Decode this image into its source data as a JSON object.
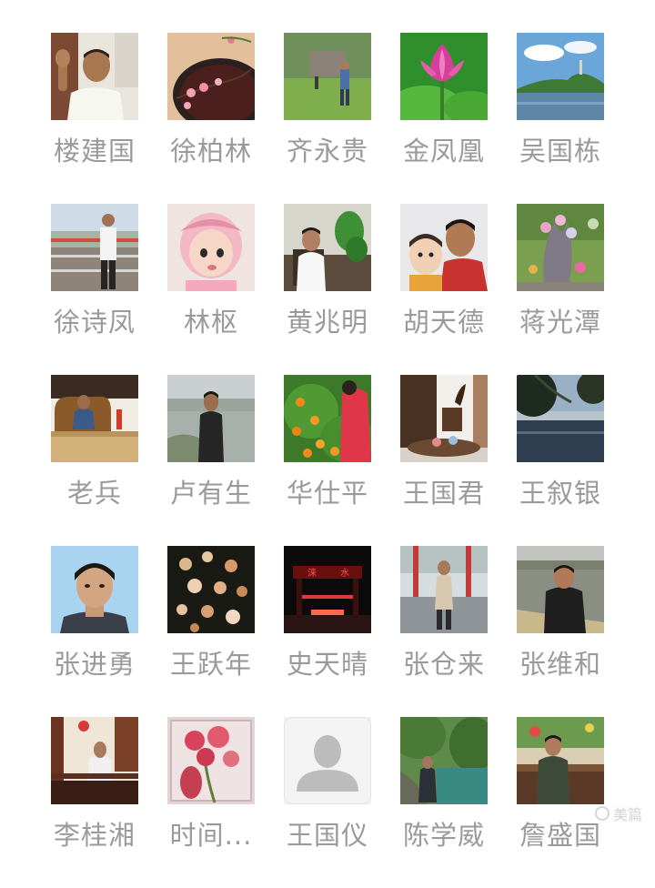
{
  "members": [
    {
      "name": "楼建国",
      "avatar": "photo-man-waving"
    },
    {
      "name": "徐柏林",
      "avatar": "photo-plum-blossom-bowl"
    },
    {
      "name": "齐永贵",
      "avatar": "photo-man-in-field"
    },
    {
      "name": "金凤凰",
      "avatar": "photo-lotus-flower"
    },
    {
      "name": "吴国栋",
      "avatar": "photo-lake-mountain"
    },
    {
      "name": "徐诗凤",
      "avatar": "photo-man-by-railing"
    },
    {
      "name": "林枢",
      "avatar": "photo-baby-pink-hat"
    },
    {
      "name": "黄兆明",
      "avatar": "photo-man-seated-plant"
    },
    {
      "name": "胡天德",
      "avatar": "photo-man-with-child"
    },
    {
      "name": "蒋光潭",
      "avatar": "photo-garden-rockery"
    },
    {
      "name": "老兵",
      "avatar": "photo-man-on-couch"
    },
    {
      "name": "卢有生",
      "avatar": "photo-man-by-lake"
    },
    {
      "name": "华仕平",
      "avatar": "photo-orange-tree"
    },
    {
      "name": "王国君",
      "avatar": "photo-root-carving-room"
    },
    {
      "name": "王叙银",
      "avatar": "photo-lake-trees"
    },
    {
      "name": "张进勇",
      "avatar": "photo-portrait-id"
    },
    {
      "name": "王跃年",
      "avatar": "photo-flowers-dark"
    },
    {
      "name": "史天晴",
      "avatar": "photo-night-gate"
    },
    {
      "name": "张仓来",
      "avatar": "photo-man-square"
    },
    {
      "name": "张维和",
      "avatar": "photo-man-riverside"
    },
    {
      "name": "李桂湘",
      "avatar": "photo-man-on-bench"
    },
    {
      "name": "时间...",
      "avatar": "photo-red-flowers-painting"
    },
    {
      "name": "王国仪",
      "avatar": "default-person-icon"
    },
    {
      "name": "陈学威",
      "avatar": "photo-man-by-river"
    },
    {
      "name": "詹盛国",
      "avatar": "photo-man-on-sofa"
    }
  ],
  "watermark": {
    "text": "美篇"
  }
}
